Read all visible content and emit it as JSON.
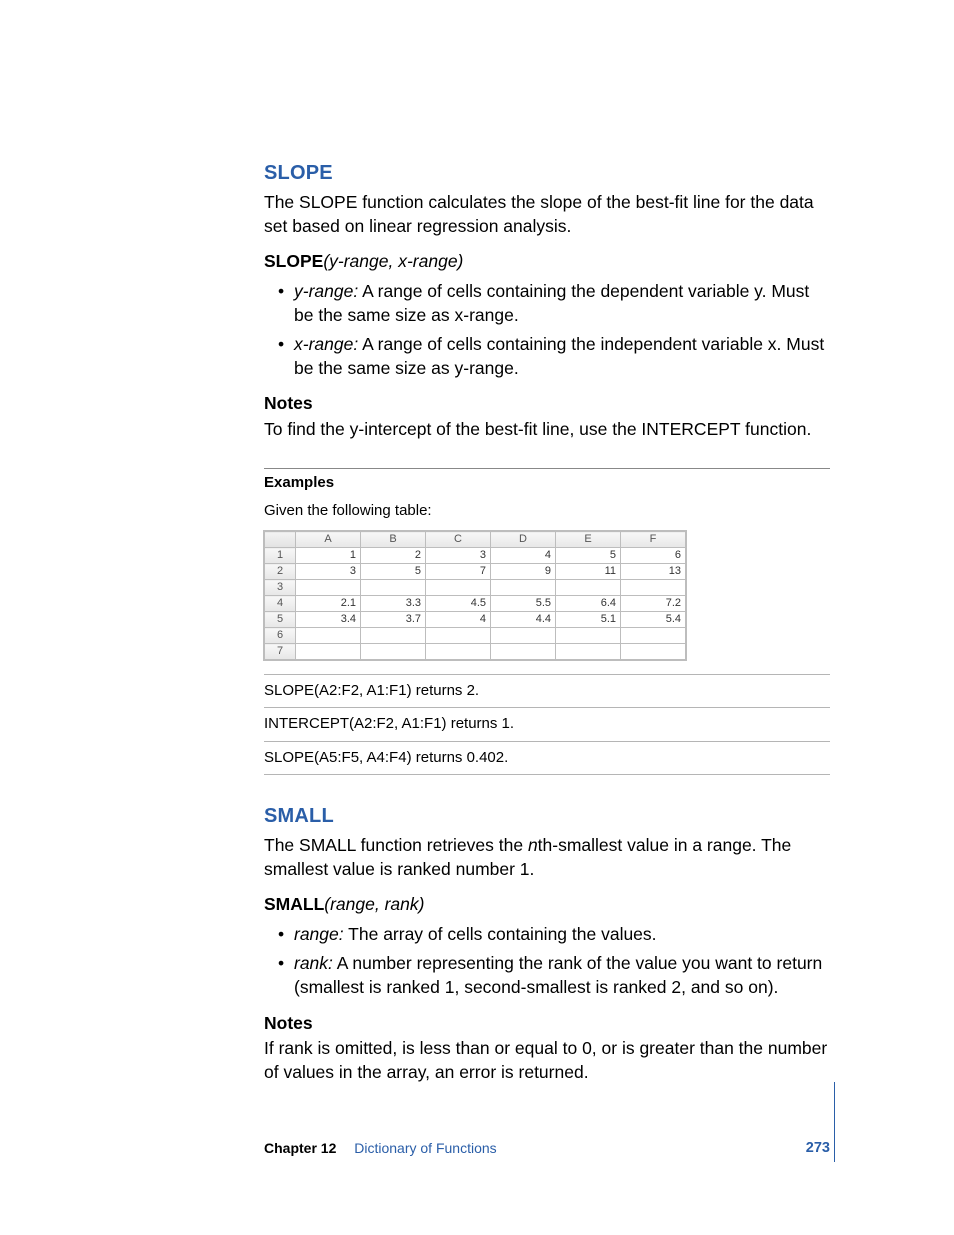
{
  "footer": {
    "chapter": "Chapter 12",
    "title": "Dictionary of Functions",
    "page": "273"
  },
  "slope": {
    "heading": "SLOPE",
    "desc": "The SLOPE function calculates the slope of the best-fit line for the data set based on linear regression analysis.",
    "sig_name": "SLOPE",
    "sig_args": "(y-range, x-range)",
    "params": [
      {
        "name": "y-range:",
        "text": "  A range of cells containing the dependent variable y. Must be the same size as x-range."
      },
      {
        "name": "x-range:",
        "text": "  A range of cells containing the independent variable x. Must be the same size as y-range."
      }
    ],
    "notes_head": "Notes",
    "notes": "To find the y-intercept of the best-fit line, use the INTERCEPT function.",
    "examples_head": "Examples",
    "examples_intro": "Given the following table:",
    "table": {
      "cols": [
        "A",
        "B",
        "C",
        "D",
        "E",
        "F"
      ],
      "rows": [
        [
          "1",
          "2",
          "3",
          "4",
          "5",
          "6"
        ],
        [
          "3",
          "5",
          "7",
          "9",
          "11",
          "13"
        ],
        [
          "",
          "",
          "",
          "",
          "",
          ""
        ],
        [
          "2.1",
          "3.3",
          "4.5",
          "5.5",
          "6.4",
          "7.2"
        ],
        [
          "3.4",
          "3.7",
          "4",
          "4.4",
          "5.1",
          "5.4"
        ],
        [
          "",
          "",
          "",
          "",
          "",
          ""
        ],
        [
          "",
          "",
          "",
          "",
          "",
          ""
        ]
      ]
    },
    "results": [
      "SLOPE(A2:F2, A1:F1) returns 2.",
      "INTERCEPT(A2:F2, A1:F1) returns 1.",
      "SLOPE(A5:F5, A4:F4) returns 0.402."
    ]
  },
  "small": {
    "heading": "SMALL",
    "desc_pre": "The SMALL function retrieves the ",
    "desc_ital": "n",
    "desc_post": "th-smallest value in a range. The smallest value is ranked number 1.",
    "sig_name": "SMALL",
    "sig_args": "(range, rank)",
    "params": [
      {
        "name": "range:",
        "text": " The array of cells containing the values."
      },
      {
        "name": "rank:",
        "text": "  A number representing the rank of the value you want to return (smallest is ranked 1, second-smallest is ranked 2, and so on)."
      }
    ],
    "notes_head": "Notes",
    "notes": "If rank is omitted, is less than or equal to 0, or is greater than the number of values in the array, an error is returned."
  }
}
